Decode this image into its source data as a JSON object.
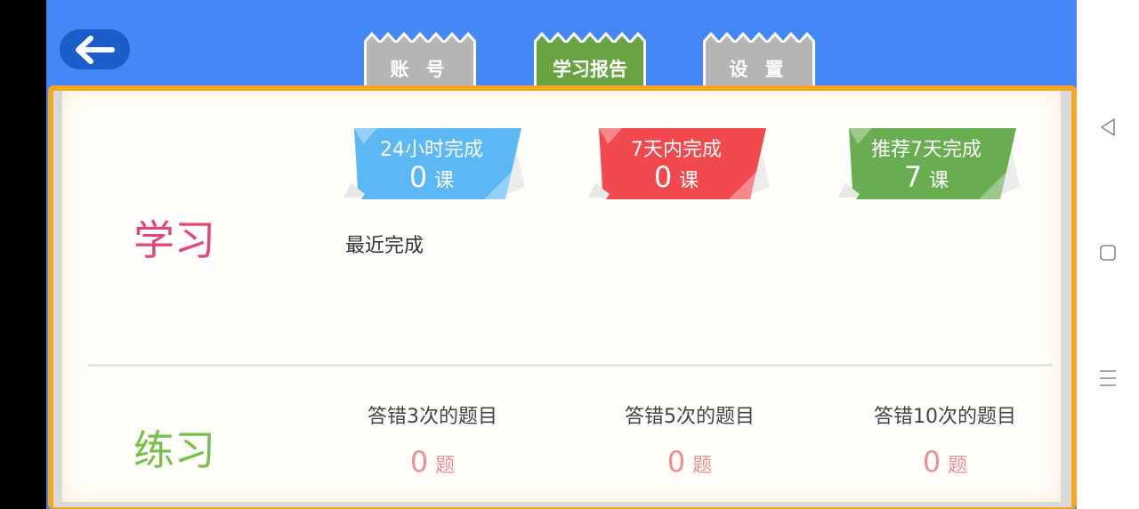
{
  "tabs": [
    {
      "label": "账 号",
      "color": "#b5b5b5"
    },
    {
      "label": "学习报告",
      "color": "#69a442",
      "active": true
    },
    {
      "label": "设 置",
      "color": "#b5b5b5"
    }
  ],
  "study": {
    "title": "学习",
    "title_color": "#e0467a",
    "ribbons": [
      {
        "title": "24小时完成",
        "count": "0",
        "unit": "课",
        "color": "#5bb8f5"
      },
      {
        "title": "7天内完成",
        "count": "0",
        "unit": "课",
        "color": "#f2494f"
      },
      {
        "title": "推荐7天完成",
        "count": "7",
        "unit": "课",
        "color": "#69ad51"
      }
    ],
    "recent_label": "最近完成"
  },
  "practice": {
    "title": "练习",
    "title_color": "#77c04a",
    "stats": [
      {
        "title": "答错3次的题目",
        "count": "0",
        "unit": "题"
      },
      {
        "title": "答错5次的题目",
        "count": "0",
        "unit": "题"
      },
      {
        "title": "答错10次的题目",
        "count": "0",
        "unit": "题"
      }
    ]
  },
  "colors": {
    "header_bg": "#4488f8",
    "card_border": "#f5a623",
    "stat_count": "#f08f8f"
  },
  "icons": {
    "back": "arrow-left-icon",
    "nav_back": "triangle-back-icon",
    "nav_home": "square-home-icon",
    "nav_menu": "menu-lines-icon"
  }
}
